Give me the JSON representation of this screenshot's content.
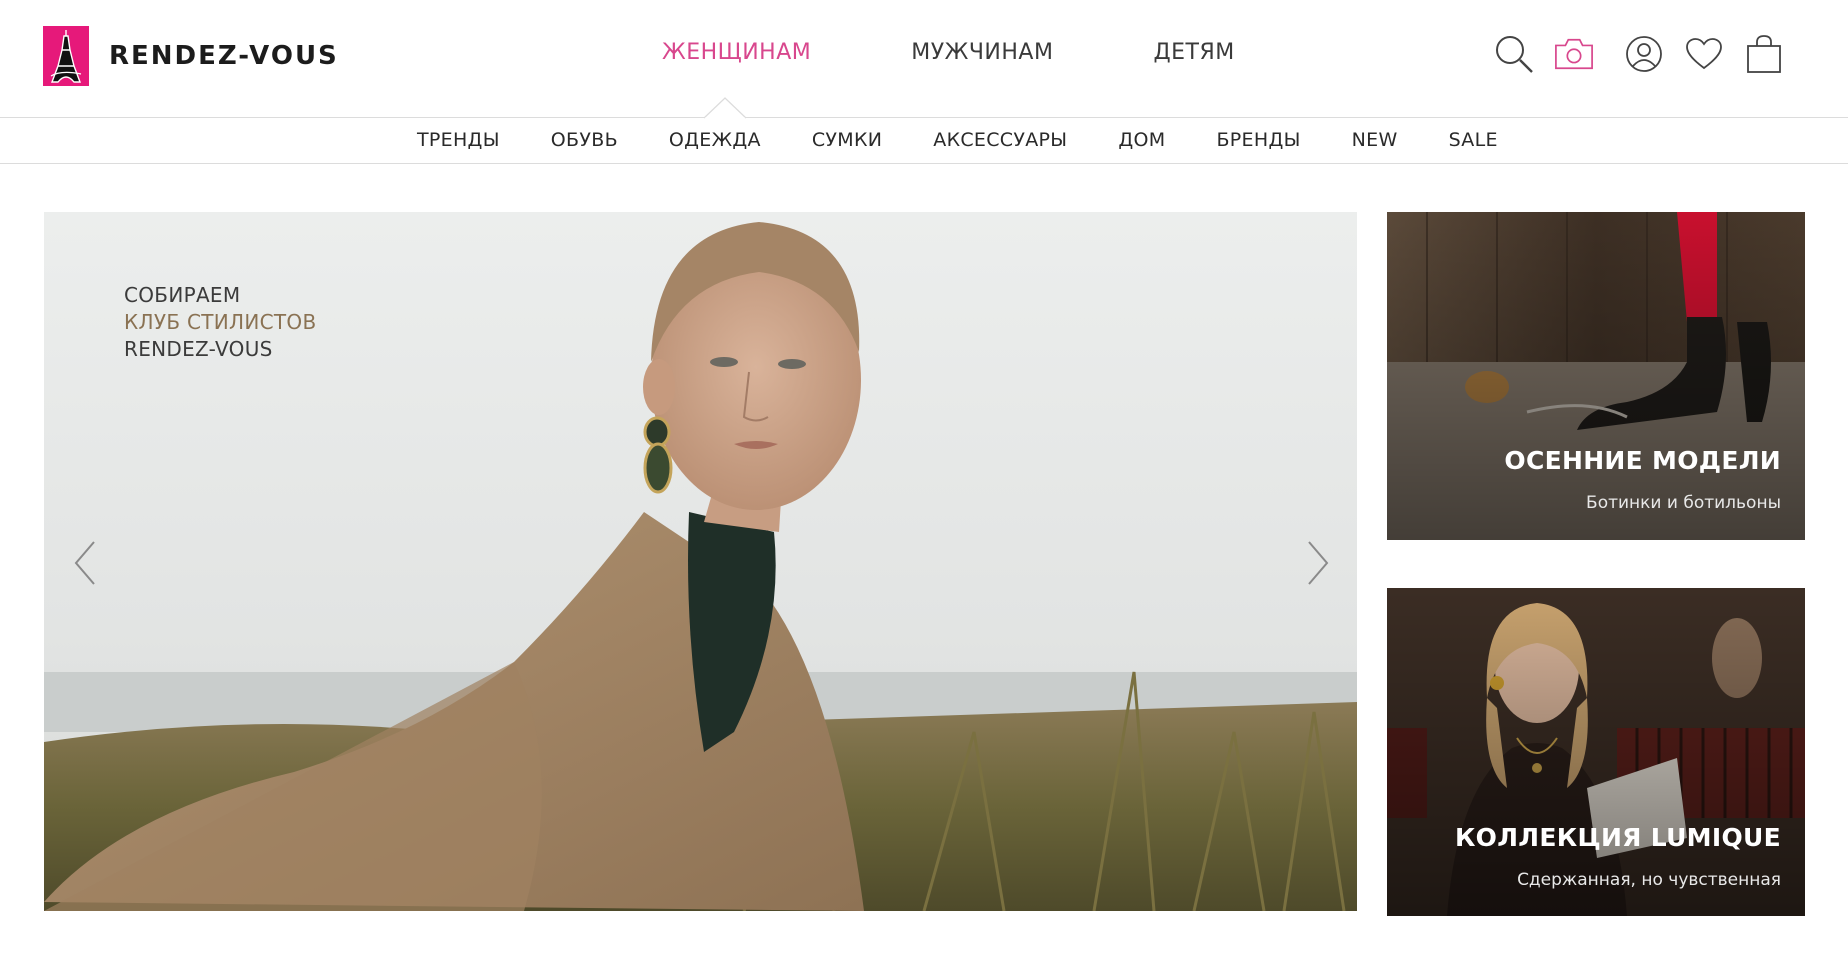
{
  "brand": {
    "name": "RENDEZ-VOUS",
    "accent": "#e6197a",
    "active_nav_color": "#d8478d"
  },
  "main_nav": [
    {
      "label": "ЖЕНЩИНАМ",
      "active": true
    },
    {
      "label": "МУЖЧИНАМ",
      "active": false
    },
    {
      "label": "ДЕТЯМ",
      "active": false
    }
  ],
  "header_icons": [
    "search-icon",
    "camera-icon",
    "account-icon",
    "heart-icon",
    "bag-icon"
  ],
  "subnav": [
    "ТРЕНДЫ",
    "ОБУВЬ",
    "ОДЕЖДА",
    "СУМКИ",
    "АКСЕССУАРЫ",
    "ДОМ",
    "БРЕНДЫ",
    "NEW",
    "SALE"
  ],
  "hero": {
    "line1": "СОБИРАЕМ",
    "line2": "КЛУБ СТИЛИСТОВ",
    "line3": "RENDEZ-VOUS"
  },
  "cards": [
    {
      "title": "ОСЕННИЕ МОДЕЛИ",
      "subtitle": "Ботинки и ботильоны"
    },
    {
      "title": "КОЛЛЕКЦИЯ LUMIQUE",
      "subtitle": "Сдержанная, но чувственная"
    }
  ]
}
